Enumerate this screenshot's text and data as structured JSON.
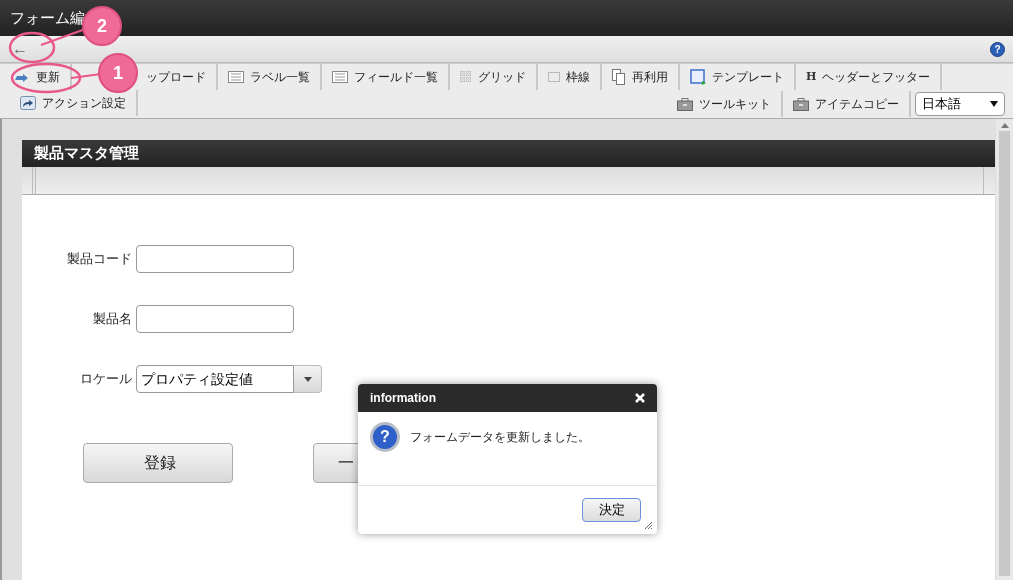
{
  "window": {
    "title": "フォーム編"
  },
  "toolbar": {
    "back_label": "←",
    "help_label": "?"
  },
  "tabs_row1": [
    {
      "label": "更新",
      "kind": "refresh"
    },
    {
      "label": "ップロード",
      "kind": "covered"
    },
    {
      "label": "ラベル一覧",
      "kind": "list"
    },
    {
      "label": "フィールド一覧",
      "kind": "list"
    },
    {
      "label": "グリッド",
      "kind": "grid"
    },
    {
      "label": "枠線",
      "kind": "border"
    },
    {
      "label": "再利用",
      "kind": "copy"
    },
    {
      "label": "テンプレート",
      "kind": "template"
    },
    {
      "label": "ヘッダーとフッター",
      "kind": "letter",
      "icon_text": "H"
    }
  ],
  "tabs_row2_left": [
    {
      "label": "アクション設定",
      "kind": "action"
    }
  ],
  "tabs_row2_right": [
    {
      "label": "ツールキット",
      "kind": "briefcase"
    },
    {
      "label": "アイテムコピー",
      "kind": "briefcase"
    }
  ],
  "language": "日本語",
  "panel": {
    "title": "製品マスタ管理",
    "fields": [
      {
        "kind": "text",
        "label": "製品コード"
      },
      {
        "kind": "text",
        "label": "製品名"
      },
      {
        "kind": "select",
        "label": "ロケール",
        "value": "プロパティ設定値"
      }
    ],
    "buttons": [
      "登録",
      "一"
    ]
  },
  "dialog": {
    "title": "information",
    "icon_text": "?",
    "message": "フォームデータを更新しました。",
    "button": "決定"
  },
  "callouts": [
    {
      "number": "1"
    },
    {
      "number": "2"
    }
  ]
}
